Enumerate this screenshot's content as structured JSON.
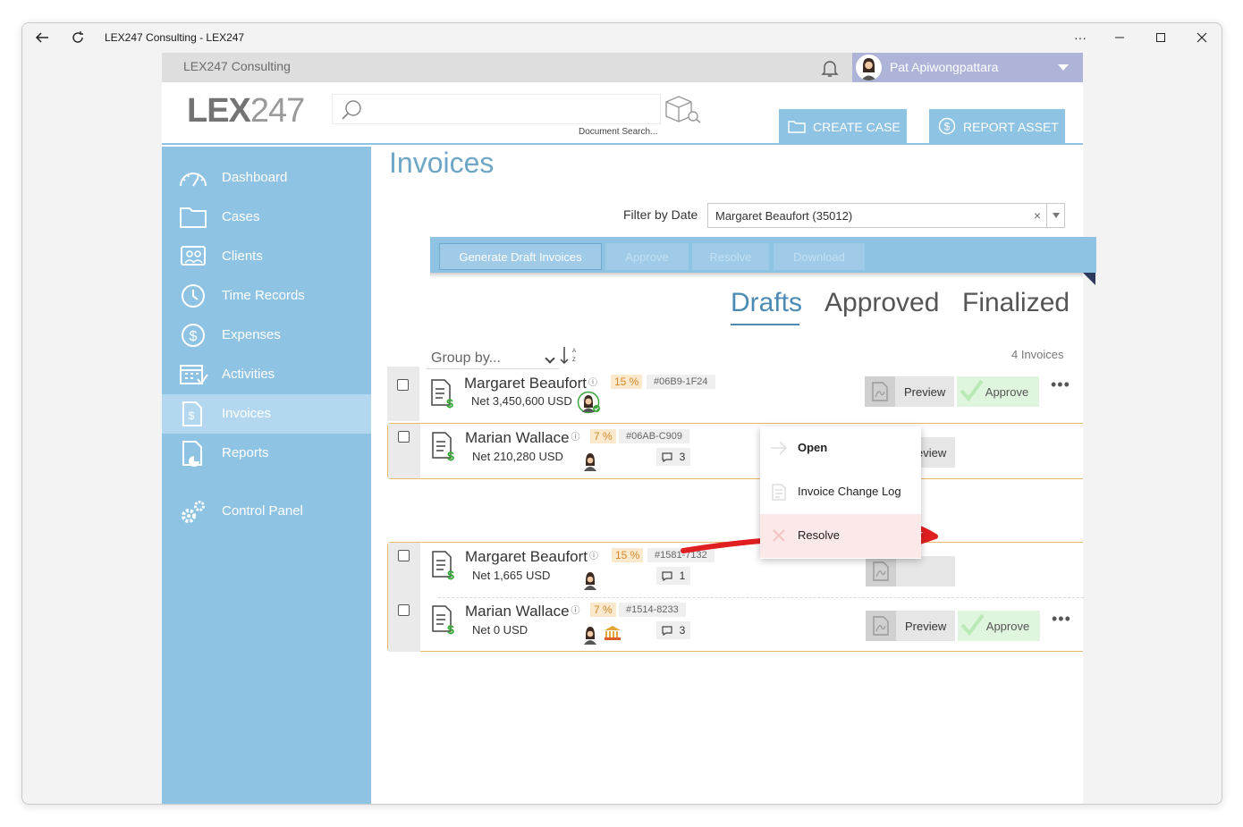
{
  "window": {
    "title": "LEX247 Consulting - LEX247"
  },
  "topbar": {
    "firm": "LEX247 Consulting",
    "user": "Pat Apiwongpattara"
  },
  "header": {
    "logo_bold": "LEX",
    "logo_light": "247",
    "search_label": "Document Search...",
    "create_case": "CREATE CASE",
    "report_asset": "REPORT ASSET"
  },
  "sidebar": {
    "items": [
      {
        "label": "Dashboard",
        "icon": "gauge-icon"
      },
      {
        "label": "Cases",
        "icon": "folder-icon"
      },
      {
        "label": "Clients",
        "icon": "clients-icon"
      },
      {
        "label": "Time Records",
        "icon": "clock-icon"
      },
      {
        "label": "Expenses",
        "icon": "dollar-icon"
      },
      {
        "label": "Activities",
        "icon": "calendar-icon"
      },
      {
        "label": "Invoices",
        "icon": "invoice-icon"
      },
      {
        "label": "Reports",
        "icon": "report-icon"
      },
      {
        "label": "Control Panel",
        "icon": "gears-icon"
      }
    ]
  },
  "page": {
    "title": "Invoices",
    "filter_label": "Filter by Date",
    "filter_value": "Margaret Beaufort (35012)",
    "filter_clear": "×",
    "toolbar": {
      "generate": "Generate Draft Invoices",
      "approve": "Approve",
      "resolve": "Resolve",
      "download": "Download"
    },
    "tabs": [
      "Drafts",
      "Approved",
      "Finalized"
    ],
    "group_by": "Group by...",
    "count": "4 Invoices"
  },
  "rows": [
    {
      "name": "Margaret Beaufort",
      "pct": "15 %",
      "code": "#06B9-1F24",
      "net": "Net 3,450,600 USD",
      "comments": ""
    },
    {
      "name": "Marian Wallace",
      "pct": "7 %",
      "code": "#06AB-C909",
      "net": "Net 210,280 USD",
      "comments": "3"
    },
    {
      "name": "Margaret Beaufort",
      "pct": "15 %",
      "code": "#1581-7132",
      "net": "Net 1,665 USD",
      "comments": "1"
    },
    {
      "name": "Marian Wallace",
      "pct": "7 %",
      "code": "#1514-8233",
      "net": "Net 0 USD",
      "comments": "3"
    }
  ],
  "row_actions": {
    "preview": "Preview",
    "approve": "Approve",
    "more": "•••",
    "info": "ⓘ"
  },
  "context_menu": {
    "open": "Open",
    "change_log": "Invoice Change Log",
    "resolve": "Resolve"
  },
  "colors": {
    "sidebar": "#8ec3e3",
    "accent": "#4c8ab3",
    "annotation": "#e02020"
  }
}
